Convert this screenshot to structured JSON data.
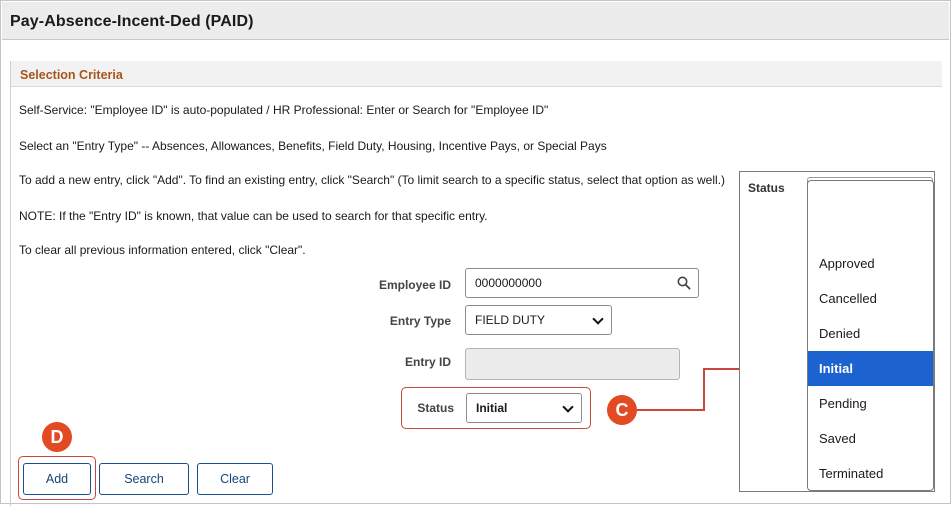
{
  "page": {
    "title": "Pay-Absence-Incent-Ded (PAID)",
    "section_title": "Selection Criteria"
  },
  "instructions": [
    "Self-Service: \"Employee ID\" is auto-populated / HR Professional: Enter or Search for \"Employee ID\"",
    "Select an \"Entry Type\" -- Absences, Allowances, Benefits, Field Duty, Housing, Incentive Pays, or Special Pays",
    "To add a new entry, click \"Add\". To find an existing entry, click \"Search\" (To limit search to a specific status, select that option as well.)",
    "NOTE: If the \"Entry ID\" is known, that value can be used to search for that specific entry.",
    "To clear all previous information entered, click \"Clear\"."
  ],
  "form": {
    "employee_id_label": "Employee ID",
    "employee_id_value": "0000000000",
    "entry_type_label": "Entry Type",
    "entry_type_value": "FIELD DUTY",
    "entry_id_label": "Entry ID",
    "entry_id_value": "",
    "status_label": "Status",
    "status_value": "Initial"
  },
  "buttons": {
    "add": "Add",
    "search": "Search",
    "clear": "Clear"
  },
  "callouts": {
    "c": "C",
    "d": "D"
  },
  "status_dropdown": {
    "label": "Status",
    "selected": "Initial",
    "options": [
      "",
      "Approved",
      "Cancelled",
      "Denied",
      "Initial",
      "Pending",
      "Saved",
      "Terminated"
    ]
  },
  "colors": {
    "section_title": "#a4561d",
    "button_border": "#1b4e8c",
    "highlight": "#c8473a",
    "marker": "#e24a22",
    "selected_option": "#1c63cf"
  },
  "icons": {
    "search": "magnifier-icon",
    "dropdown": "chevron-down-icon"
  }
}
